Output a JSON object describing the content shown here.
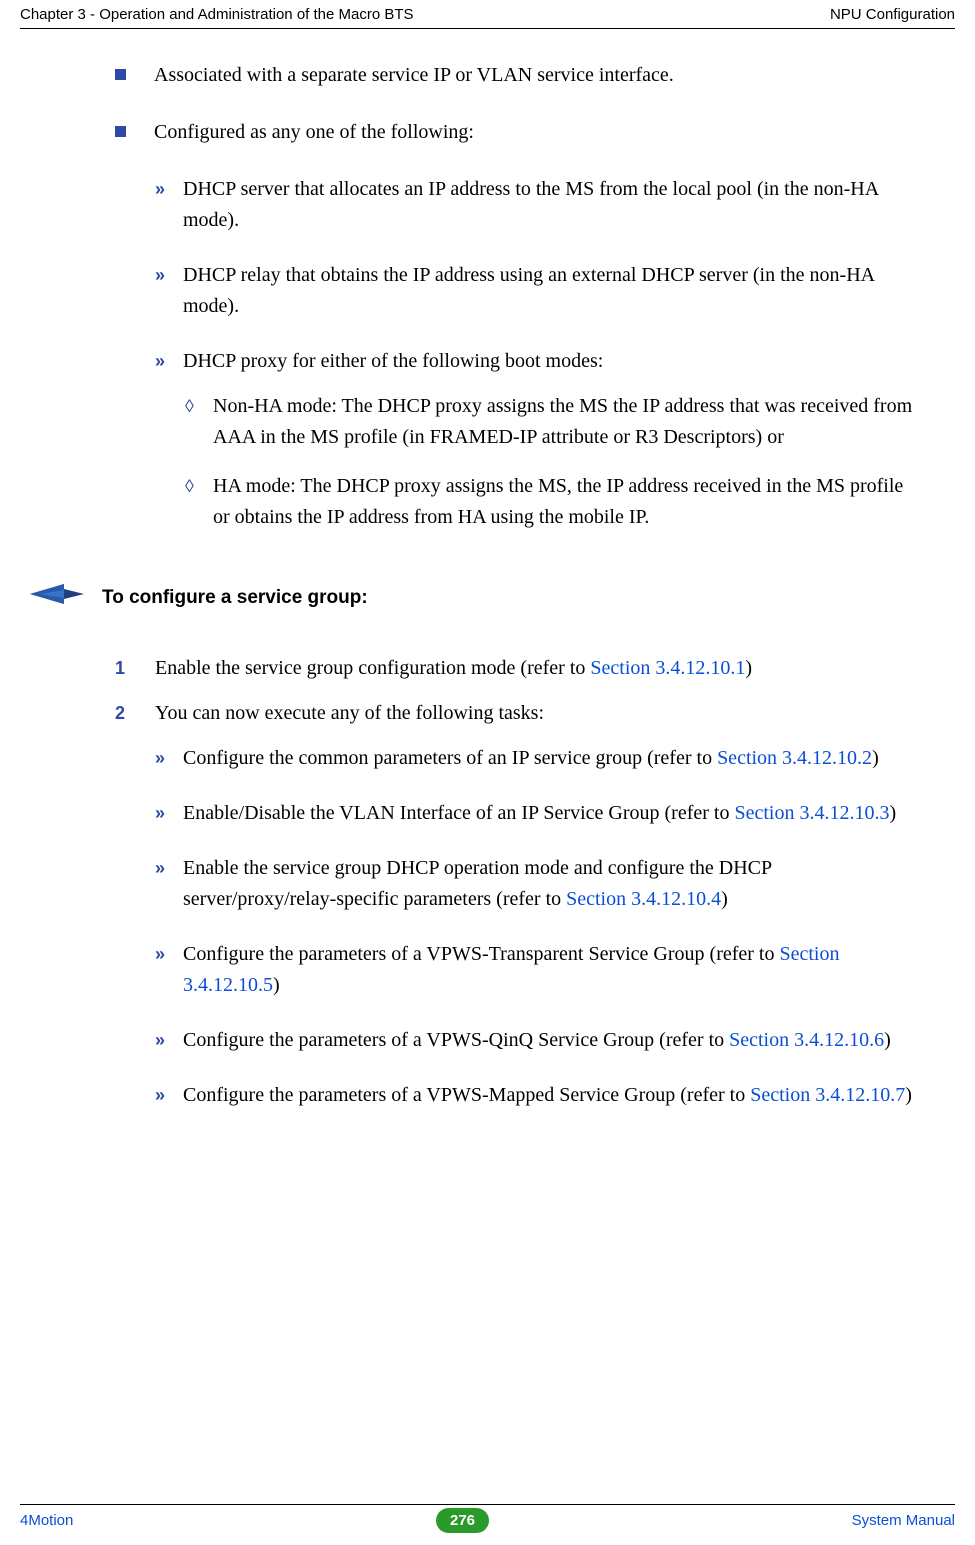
{
  "header": {
    "left": "Chapter 3 - Operation and Administration of the Macro BTS",
    "right": "NPU Configuration"
  },
  "bullets": {
    "b1": "Associated with a separate service IP or VLAN service interface.",
    "b2": "Configured as any one of the following:"
  },
  "sub": {
    "s1": "DHCP server that allocates an IP address to the MS from the local pool (in the non-HA mode).",
    "s2": "DHCP relay that obtains the IP address using an external DHCP server (in the non-HA mode).",
    "s3": "DHCP proxy for either of the following boot modes:"
  },
  "dia": {
    "d1": "Non-HA mode: The DHCP proxy assigns the MS the IP address that was received from AAA in the MS profile (in FRAMED-IP attribute or R3 Descriptors) or",
    "d2": "HA mode: The DHCP proxy assigns the MS, the IP address received in the MS profile or obtains the IP address from HA using the mobile IP."
  },
  "procedure": {
    "title": "To configure a service group:"
  },
  "steps": {
    "n1": "1",
    "t1a": "Enable the service group configuration mode (refer to ",
    "t1link": "Section 3.4.12.10.1",
    "t1b": ")",
    "n2": "2",
    "t2": "You can now execute any of the following tasks:"
  },
  "tasks": {
    "a_pre": "Configure the common parameters of an IP service group (refer to ",
    "a_link": "Section 3.4.12.10.2",
    "a_post": ")",
    "b_pre": "Enable/Disable the VLAN Interface of an IP Service Group (refer to ",
    "b_link": "Section 3.4.12.10.3",
    "b_post": ")",
    "c_pre": "Enable the service group DHCP operation mode and configure the DHCP server/proxy/relay-specific parameters (refer to ",
    "c_link": "Section 3.4.12.10.4",
    "c_post": ")",
    "d_pre": "Configure the parameters of a VPWS-Transparent Service Group (refer to ",
    "d_link": "Section 3.4.12.10.5",
    "d_post": ")",
    "e_pre": "Configure the parameters of a VPWS-QinQ Service Group (refer to ",
    "e_link": "Section 3.4.12.10.6",
    "e_post": ")",
    "f_pre": "Configure the parameters of a VPWS-Mapped Service Group (refer to ",
    "f_link": "Section 3.4.12.10.7",
    "f_post": ")"
  },
  "footer": {
    "left": "4Motion",
    "page": "276",
    "right": "System Manual"
  }
}
